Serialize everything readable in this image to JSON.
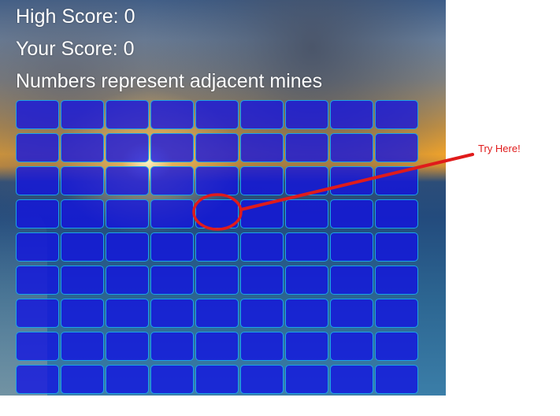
{
  "scoreboard": {
    "high_score_label": "High Score: ",
    "high_score": "0",
    "your_score_label": "Your Score: ",
    "your_score": "0"
  },
  "hint": "Numbers represent adjacent mines",
  "grid": {
    "rows": 9,
    "cols": 9,
    "highlight_cell": {
      "row": 4,
      "col": 5
    }
  },
  "annotation": {
    "label": "Try Here!",
    "color": "#e01b1b"
  },
  "colors": {
    "cell_fill": "#1212e1",
    "cell_border": "#1aa3e8",
    "text": "#ffffff"
  }
}
